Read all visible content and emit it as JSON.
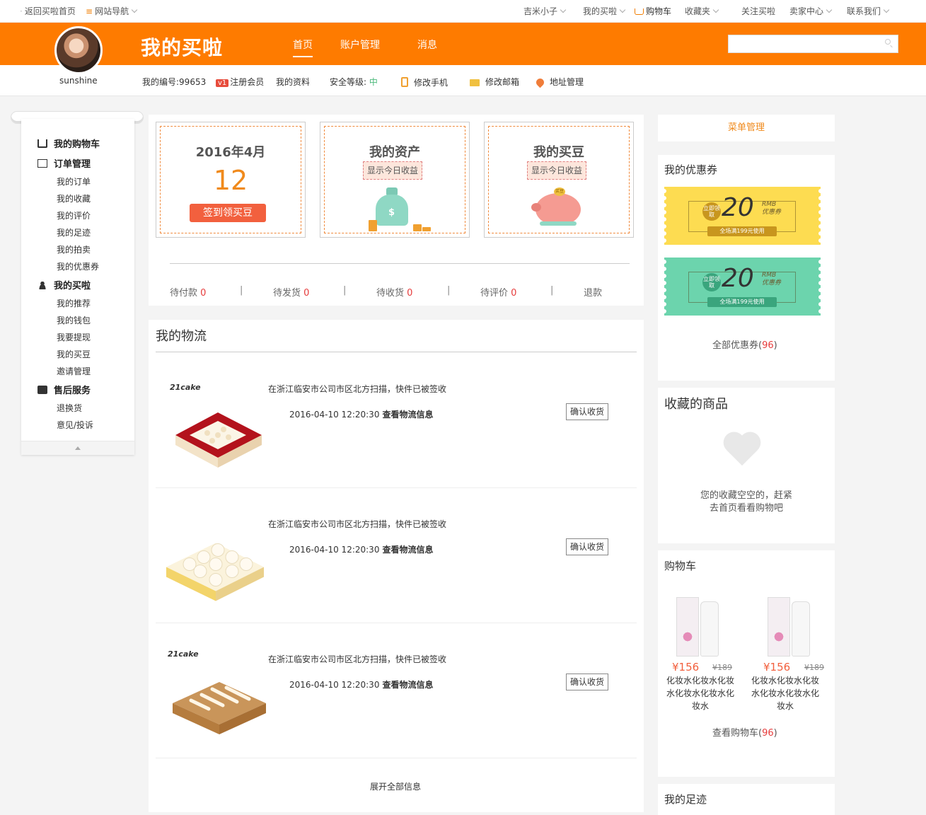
{
  "topbar": {
    "back_home": "返回买啦首页",
    "site_nav": "网站导航",
    "user": "吉米小子",
    "my_maila": "我的买啦",
    "cart": "购物车",
    "favorites": "收藏夹",
    "follow": "关注买啦",
    "seller": "卖家中心",
    "contact": "联系我们"
  },
  "header": {
    "brand": "我的买啦",
    "nav": [
      "首页",
      "账户管理",
      "消息"
    ],
    "search_placeholder": ""
  },
  "profile": {
    "username": "sunshine",
    "id_label": "我的编号:99653",
    "vip_badge": "v1",
    "register": "注册会员",
    "my_info": "我的资料",
    "security_label": "安全等级:",
    "security_value": "中",
    "modify_phone": "修改手机",
    "modify_email": "修改邮箱",
    "address": "地址管理"
  },
  "sidebar": {
    "groups": [
      {
        "title": "我的购物车",
        "items": []
      },
      {
        "title": "订单管理",
        "items": [
          "我的订单",
          "我的收藏",
          "我的评价",
          "我的足迹",
          "我的拍卖",
          "我的优惠券"
        ]
      },
      {
        "title": "我的买啦",
        "items": [
          "我的推荐",
          "我的钱包",
          "我要提现",
          "我的买豆",
          "邀请管理"
        ]
      },
      {
        "title": "售后服务",
        "items": [
          "退换货",
          "意见/投诉"
        ]
      }
    ]
  },
  "stats": {
    "date_title": "2016年4月",
    "day_count": "12",
    "sign_button": "签到领买豆",
    "assets_title": "我的资产",
    "assets_button": "显示今日收益",
    "beans_title": "我的买豆",
    "beans_button": "显示今日收益",
    "coin_label": "买豆"
  },
  "orders": [
    {
      "label": "待付款",
      "count": "0"
    },
    {
      "label": "待发货",
      "count": "0"
    },
    {
      "label": "待收货",
      "count": "0"
    },
    {
      "label": "待评价",
      "count": "0"
    },
    {
      "label": "退款",
      "count": ""
    }
  ],
  "logistics": {
    "title": "我的物流",
    "rows": [
      {
        "brand": "21cake",
        "text": "在浙江临安市公司市区北方扫描，快件已被签收",
        "time": "2016-04-10 12:20:30",
        "link": "查看物流信息",
        "button": "确认收货"
      },
      {
        "brand": "",
        "text": "在浙江临安市公司市区北方扫描，快件已被签收",
        "time": "2016-04-10 12:20:30",
        "link": "查看物流信息",
        "button": "确认收货"
      },
      {
        "brand": "21cake",
        "text": "在浙江临安市公司市区北方扫描，快件已被签收",
        "time": "2016-04-10 12:20:30",
        "link": "查看物流信息",
        "button": "确认收货"
      }
    ],
    "expand": "展开全部信息"
  },
  "right": {
    "menu_mgmt": "菜单管理",
    "coupons_title": "我的优惠券",
    "coupons": [
      {
        "badge": "立即领取",
        "amount": "20",
        "rmb": "RMB",
        "unit": "优惠券",
        "condition": "全场满199元使用",
        "bg": "#fddc51",
        "accent": "#c8961e"
      },
      {
        "badge": "立即领取",
        "amount": "20",
        "rmb": "RMB",
        "unit": "优惠券",
        "condition": "全场满199元使用",
        "bg": "#6cd4ad",
        "accent": "#3aa57d"
      }
    ],
    "all_coupons": "全部优惠券",
    "all_coupons_count": "96",
    "favorites_title": "收藏的商品",
    "favorites_empty_1": "您的收藏空空的，赶紧",
    "favorites_empty_2": "去首页看看购物吧",
    "cart_title": "购物车",
    "cart_items": [
      {
        "price": "¥156",
        "old_price": "¥189",
        "name": "化妆水化妆水化妆水化妆水化妆水化妆水"
      },
      {
        "price": "¥156",
        "old_price": "¥189",
        "name": "化妆水化妆水化妆水化妆水化妆水化妆水"
      }
    ],
    "view_cart": "查看购物车",
    "view_cart_count": "96",
    "footprint_title": "我的足迹"
  },
  "colors": {
    "brand": "#fe7b00",
    "accent_red": "#e63c3c",
    "button_red": "#f2603e",
    "safe_green": "#4cb97b"
  }
}
